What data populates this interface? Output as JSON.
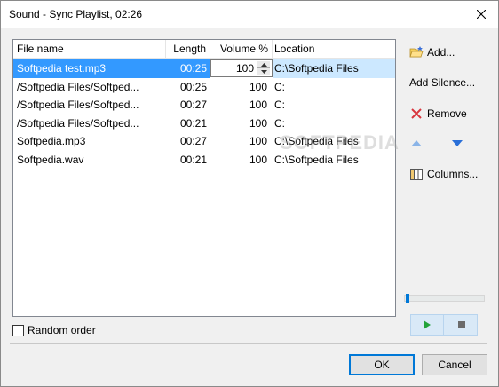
{
  "window": {
    "title": "Sound - Sync Playlist, 02:26"
  },
  "columns": {
    "file": "File name",
    "length": "Length",
    "volume": "Volume %",
    "location": "Location"
  },
  "rows": [
    {
      "file": "Softpedia test.mp3",
      "length": "00:25",
      "volume": "100",
      "location": "C:\\Softpedia Files",
      "selected": true
    },
    {
      "file": "/Softpedia Files/Softped...",
      "length": "00:25",
      "volume": "100",
      "location": "C:"
    },
    {
      "file": "/Softpedia Files/Softped...",
      "length": "00:27",
      "volume": "100",
      "location": "C:"
    },
    {
      "file": "/Softpedia Files/Softped...",
      "length": "00:21",
      "volume": "100",
      "location": "C:"
    },
    {
      "file": "Softpedia.mp3",
      "length": "00:27",
      "volume": "100",
      "location": "C:\\Softpedia Files"
    },
    {
      "file": "Softpedia.wav",
      "length": "00:21",
      "volume": "100",
      "location": "C:\\Softpedia Files"
    }
  ],
  "watermark": "SOFTPEDIA",
  "side": {
    "add": "Add...",
    "add_silence": "Add Silence...",
    "remove": "Remove",
    "columns": "Columns..."
  },
  "random_order": {
    "label": "Random order",
    "checked": false
  },
  "buttons": {
    "ok": "OK",
    "cancel": "Cancel"
  },
  "player": {
    "position": 0.0
  },
  "colors": {
    "selection": "#3399ff",
    "accent": "#0078d7",
    "remove": "#d9363e",
    "play": "#22a33a"
  }
}
